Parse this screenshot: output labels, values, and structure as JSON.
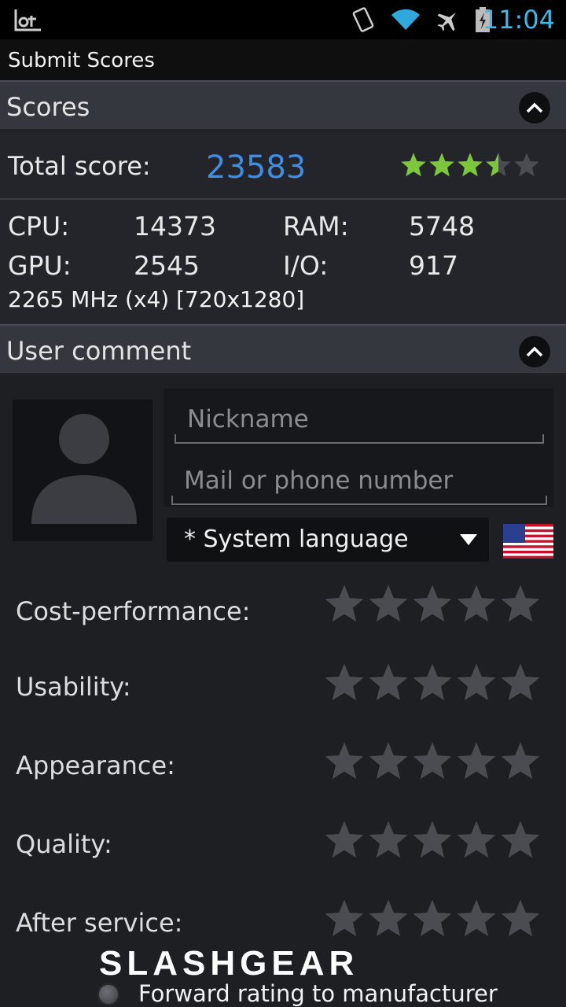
{
  "status_bar": {
    "time": "11:04"
  },
  "title_bar": {
    "title": "Submit Scores"
  },
  "scores_section": {
    "header": "Scores"
  },
  "total": {
    "label": "Total score:",
    "value": "23583",
    "stars": 3.5,
    "max_stars": 5
  },
  "metrics": [
    {
      "label": "CPU:",
      "value": "14373"
    },
    {
      "label": "RAM:",
      "value": "5748"
    },
    {
      "label": "GPU:",
      "value": "2545"
    },
    {
      "label": "I/O:",
      "value": "917"
    }
  ],
  "device_info": "2265 MHz (x4) [720x1280]",
  "comment_section": {
    "header": "User comment"
  },
  "form": {
    "nickname_placeholder": "Nickname",
    "nickname_value": "",
    "contact_placeholder": "Mail or phone number",
    "contact_value": "",
    "language": "* System language"
  },
  "ratings": [
    {
      "label": "Cost-performance:",
      "value": 0
    },
    {
      "label": "Usability:",
      "value": 0
    },
    {
      "label": "Appearance:",
      "value": 0
    },
    {
      "label": "Quality:",
      "value": 0
    },
    {
      "label": "After service:",
      "value": 0
    }
  ],
  "forward": {
    "label": "Forward rating to manufacturer",
    "checked": false
  },
  "watermark": "SLASHGEAR",
  "colors": {
    "accent": "#3d8ee6",
    "star_filled": "#7cc83a",
    "star_empty": "#4a4c52",
    "clock": "#3fb7e8"
  }
}
